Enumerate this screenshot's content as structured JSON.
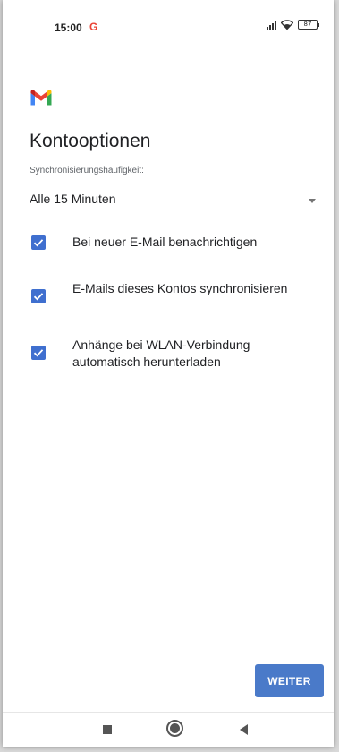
{
  "status_bar": {
    "time": "15:00",
    "google_indicator": "G",
    "battery": "87",
    "icons": [
      "signal-icon",
      "wifi-icon",
      "battery-icon"
    ]
  },
  "app": {
    "logo": "gmail-logo",
    "title": "Kontooptionen"
  },
  "sync": {
    "label": "Synchronisierungshäufigkeit:",
    "value": "Alle 15 Minuten"
  },
  "options": [
    {
      "label": "Bei neuer E-Mail benachrichtigen",
      "checked": true
    },
    {
      "label": "E-Mails dieses Kontos synchronisieren",
      "checked": true
    },
    {
      "label": "Anhänge bei WLAN-Verbindung automatisch herunterladen",
      "checked": true
    }
  ],
  "actions": {
    "next_label": "WEITER"
  },
  "nav_bar": {
    "buttons": [
      "recent-apps",
      "home",
      "back"
    ]
  },
  "colors": {
    "accent": "#4a7ac9",
    "checkbox": "#3f6fcf",
    "text": "#202124",
    "secondary_text": "#5f6368",
    "google_red": "#ea4335"
  }
}
